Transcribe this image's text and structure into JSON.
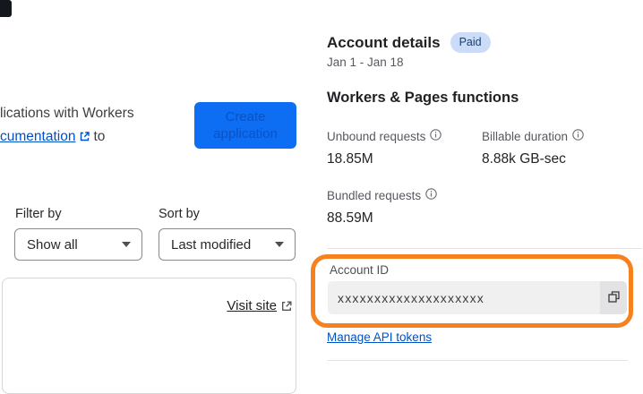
{
  "left": {
    "intro_line1": "lications with Workers",
    "intro_link_text": "cumentation",
    "intro_suffix": "to",
    "create_button_label": "Create application",
    "filter_label": "Filter by",
    "filter_value": "Show all",
    "sort_label": "Sort by",
    "sort_value": "Last modified",
    "visit_site_label": "Visit site"
  },
  "account": {
    "title": "Account details",
    "badge": "Paid",
    "date_range": "Jan 1 - Jan 18",
    "section_title": "Workers & Pages functions",
    "stats": [
      {
        "label": "Unbound requests",
        "value": "18.85M"
      },
      {
        "label": "Billable duration",
        "value": "8.88k GB-sec"
      },
      {
        "label": "Bundled requests",
        "value": "88.59M"
      }
    ],
    "account_id_label": "Account ID",
    "account_id_value": "xxxxxxxxxxxxxxxxxxxx",
    "manage_link_label": "Manage API tokens"
  },
  "icons": {
    "external_link": "external-link-icon",
    "info": "info-icon",
    "copy": "copy-icon",
    "chevron_down": "chevron-down-icon"
  },
  "colors": {
    "annotation_orange": "#F6821F",
    "button_blue_bg": "#0D6EF4",
    "button_blue_text": "#0B52C4",
    "link_blue": "#0051C3",
    "badge_bg": "#CBDCF8",
    "badge_text": "#1C3D6E",
    "input_bg": "#F0F0F1",
    "copy_btn_bg": "#E3E3E5"
  }
}
